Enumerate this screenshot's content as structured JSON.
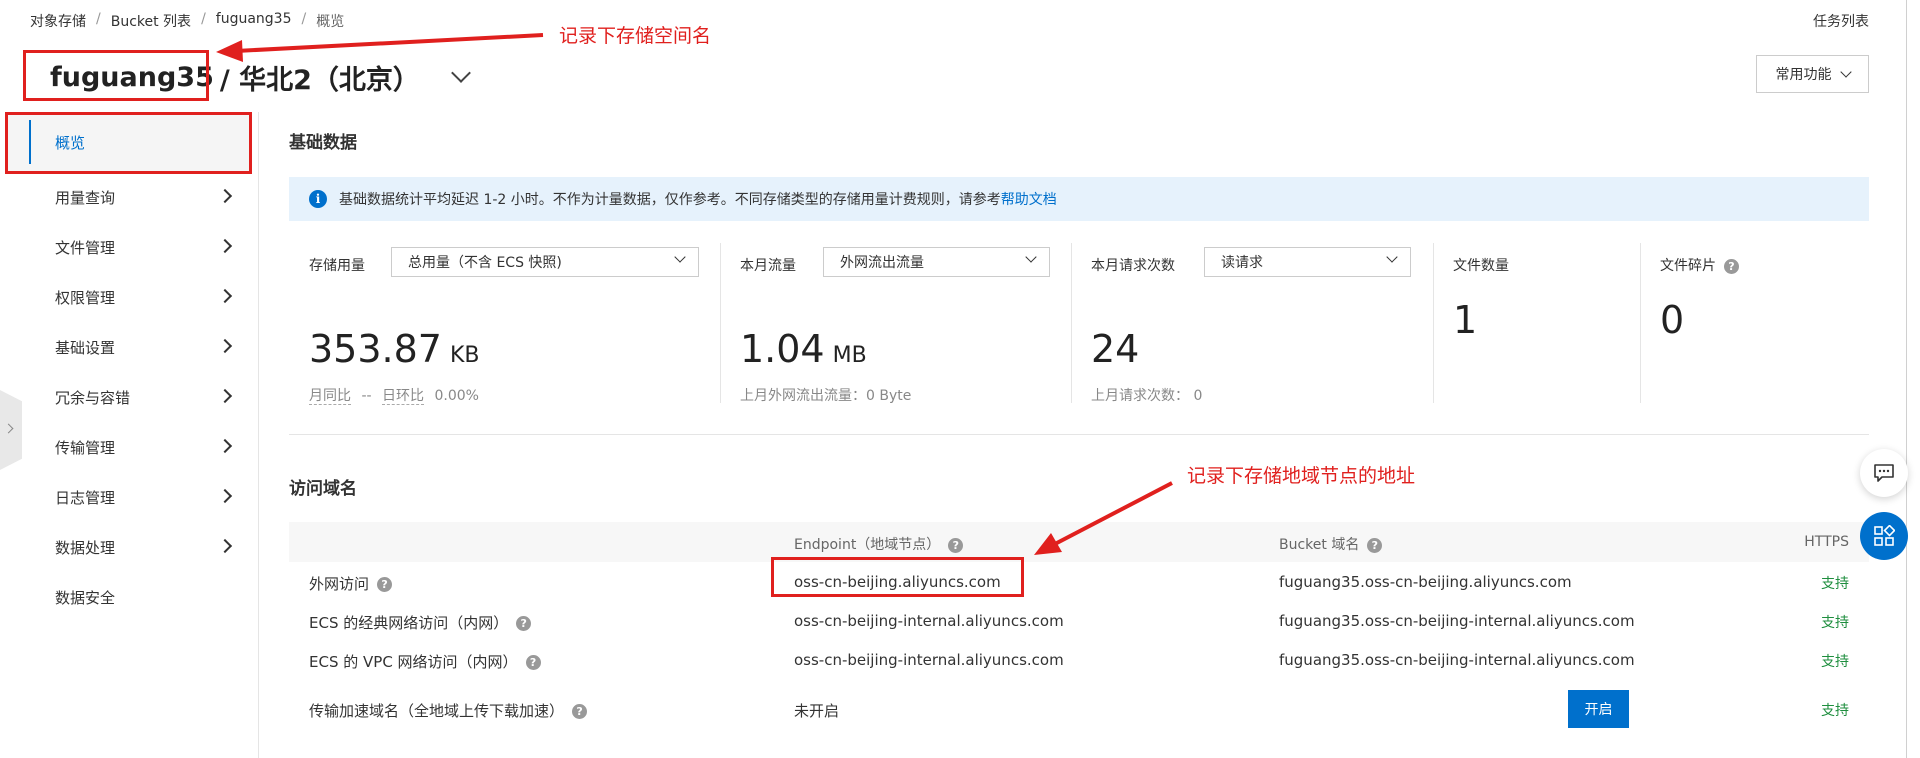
{
  "breadcrumb": {
    "items": [
      "对象存储",
      "Bucket 列表",
      "fuguang35",
      "概览"
    ],
    "sep": "/"
  },
  "header": {
    "task_list": "任务列表",
    "bucket_name": "fuguang35",
    "region": "/ 华北2（北京）",
    "common_functions": "常用功能"
  },
  "sidebar": {
    "items": [
      {
        "label": "概览",
        "active": true
      },
      {
        "label": "用量查询"
      },
      {
        "label": "文件管理"
      },
      {
        "label": "权限管理"
      },
      {
        "label": "基础设置"
      },
      {
        "label": "冗余与容错"
      },
      {
        "label": "传输管理"
      },
      {
        "label": "日志管理"
      },
      {
        "label": "数据处理"
      },
      {
        "label": "数据安全"
      }
    ]
  },
  "basic_data": {
    "title": "基础数据",
    "info_text": "基础数据统计平均延迟 1-2 小时。不作为计量数据，仅作参考。不同存储类型的存储用量计费规则，请参考",
    "info_link": "帮助文档",
    "storage": {
      "label": "存储用量",
      "select": "总用量（不含 ECS 快照)",
      "value": "353.87",
      "unit": "KB",
      "yoy_label": "月同比",
      "yoy_value": "--",
      "dod_label": "日环比",
      "dod_value": "0.00%"
    },
    "traffic": {
      "label": "本月流量",
      "select": "外网流出流量",
      "value": "1.04",
      "unit": "MB",
      "sub": "上月外网流出流量：0 Byte"
    },
    "requests": {
      "label": "本月请求次数",
      "select": "读请求",
      "value": "24",
      "sub": "上月请求次数：  0"
    },
    "files": {
      "label": "文件数量",
      "value": "1"
    },
    "fragments": {
      "label": "文件碎片",
      "value": "0"
    }
  },
  "domains": {
    "title": "访问域名",
    "columns": {
      "endpoint": "Endpoint（地域节点）",
      "bucket_domain": "Bucket 域名",
      "https": "HTTPS"
    },
    "rows": [
      {
        "name": "外网访问",
        "endpoint": "oss-cn-beijing.aliyuncs.com",
        "bucket_domain": "fuguang35.oss-cn-beijing.aliyuncs.com",
        "https": "支持"
      },
      {
        "name": "ECS 的经典网络访问（内网）",
        "endpoint": "oss-cn-beijing-internal.aliyuncs.com",
        "bucket_domain": "fuguang35.oss-cn-beijing-internal.aliyuncs.com",
        "https": "支持"
      },
      {
        "name": "ECS 的 VPC 网络访问（内网）",
        "endpoint": "oss-cn-beijing-internal.aliyuncs.com",
        "bucket_domain": "fuguang35.oss-cn-beijing-internal.aliyuncs.com",
        "https": "支持"
      },
      {
        "name": "传输加速域名（全地域上传下载加速）",
        "endpoint": "未开启",
        "button": "开启",
        "https": "支持"
      }
    ]
  },
  "annotations": {
    "bucket_note": "记录下存储空间名",
    "endpoint_note": "记录下存储地域节点的地址"
  },
  "icons": {
    "info": "i",
    "help": "?"
  },
  "colors": {
    "accent": "#0070cc",
    "annotation": "#e0201e",
    "success": "#1e8e3e"
  }
}
